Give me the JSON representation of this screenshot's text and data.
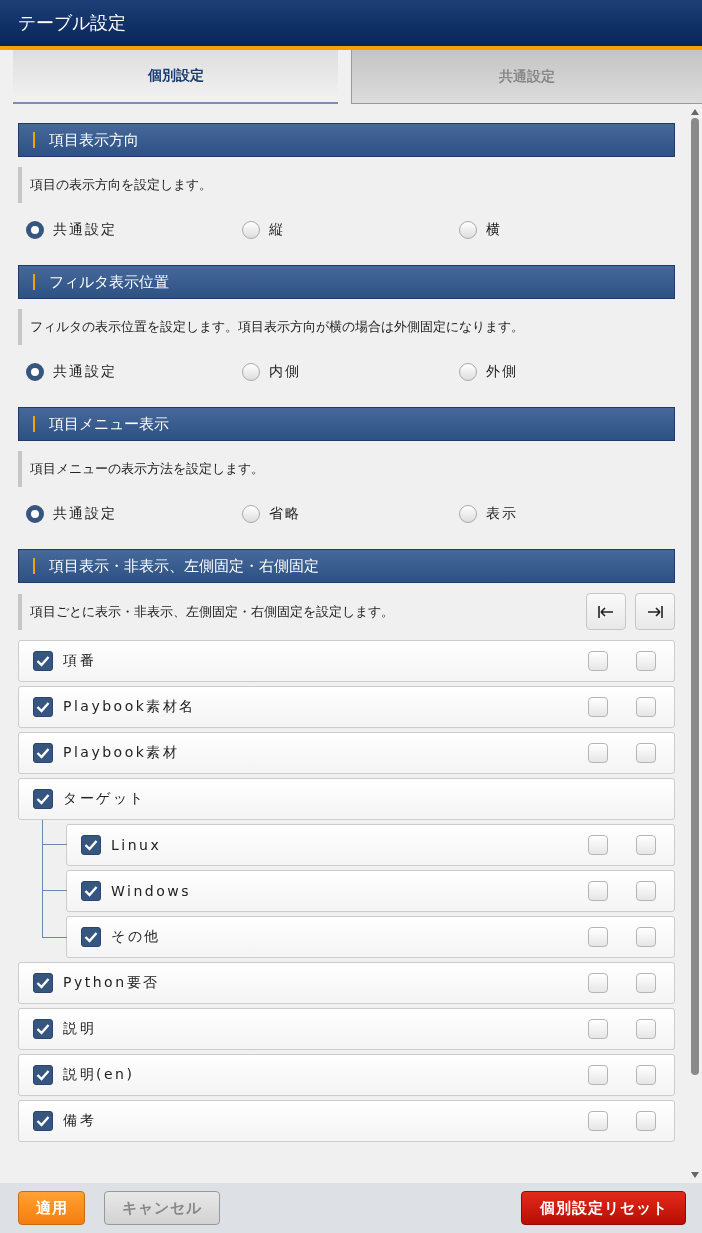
{
  "window": {
    "title": "テーブル設定"
  },
  "tabs": [
    {
      "label": "個別設定",
      "selected": true
    },
    {
      "label": "共通設定",
      "selected": false
    }
  ],
  "sections": [
    {
      "title": "項目表示方向",
      "description": "項目の表示方向を設定します。",
      "options": [
        {
          "label": "共通設定",
          "selected": true
        },
        {
          "label": "縦",
          "selected": false
        },
        {
          "label": "横",
          "selected": false
        }
      ]
    },
    {
      "title": "フィルタ表示位置",
      "description": "フィルタの表示位置を設定します。項目表示方向が横の場合は外側固定になります。",
      "options": [
        {
          "label": "共通設定",
          "selected": true
        },
        {
          "label": "内側",
          "selected": false
        },
        {
          "label": "外側",
          "selected": false
        }
      ]
    },
    {
      "title": "項目メニュー表示",
      "description": "項目メニューの表示方法を設定します。",
      "options": [
        {
          "label": "共通設定",
          "selected": true
        },
        {
          "label": "省略",
          "selected": false
        },
        {
          "label": "表示",
          "selected": false
        }
      ]
    }
  ],
  "columns_section": {
    "title": "項目表示・非表示、左側固定・右側固定",
    "description": "項目ごとに表示・非表示、左側固定・右側固定を設定します。",
    "items": [
      {
        "label": "項番",
        "checked": true,
        "left_fixed": false,
        "right_fixed": false
      },
      {
        "label": "Playbook素材名",
        "checked": true,
        "left_fixed": false,
        "right_fixed": false
      },
      {
        "label": "Playbook素材",
        "checked": true,
        "left_fixed": false,
        "right_fixed": false
      },
      {
        "label": "ターゲット",
        "checked": true,
        "children": [
          {
            "label": "Linux",
            "checked": true,
            "left_fixed": false,
            "right_fixed": false
          },
          {
            "label": "Windows",
            "checked": true,
            "left_fixed": false,
            "right_fixed": false
          },
          {
            "label": "その他",
            "checked": true,
            "left_fixed": false,
            "right_fixed": false
          }
        ]
      },
      {
        "label": "Python要否",
        "checked": true,
        "left_fixed": false,
        "right_fixed": false
      },
      {
        "label": "説明",
        "checked": true,
        "left_fixed": false,
        "right_fixed": false
      },
      {
        "label": "説明(en)",
        "checked": true,
        "left_fixed": false,
        "right_fixed": false
      },
      {
        "label": "備考",
        "checked": true,
        "left_fixed": false,
        "right_fixed": false
      }
    ]
  },
  "footer": {
    "apply": "適用",
    "cancel": "キャンセル",
    "reset": "個別設定リセット"
  }
}
